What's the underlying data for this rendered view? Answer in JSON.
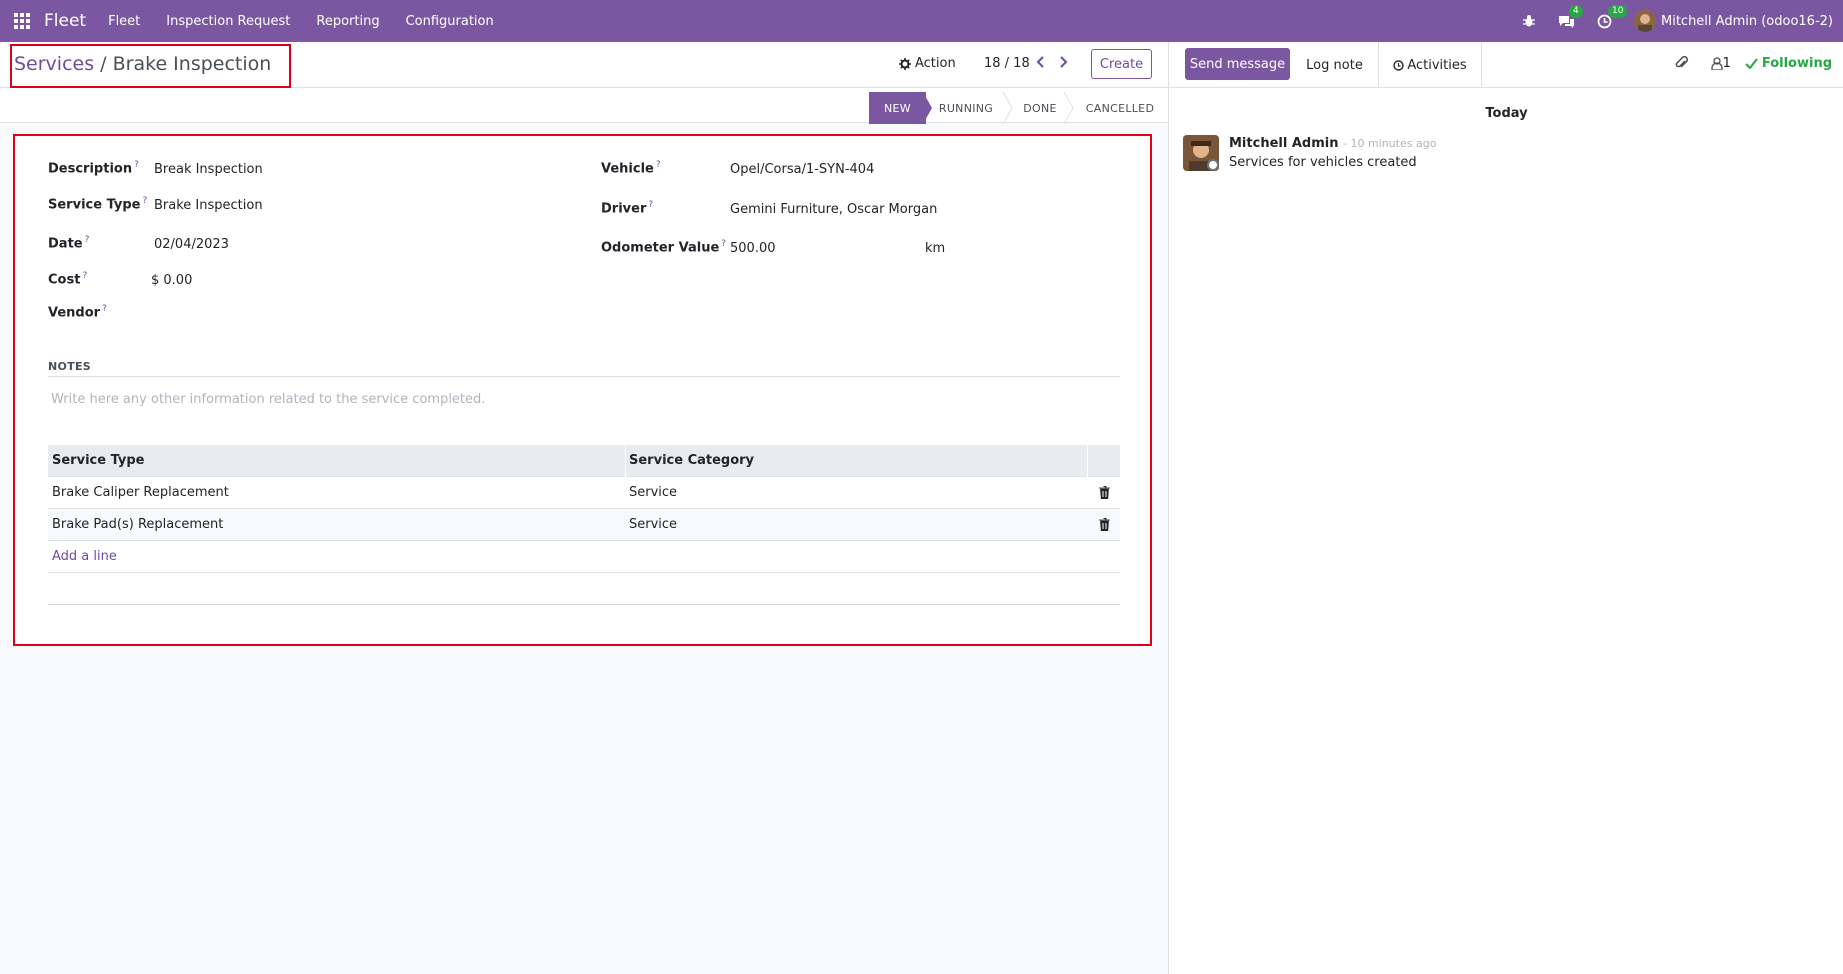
{
  "navbar": {
    "brand": "Fleet",
    "menus": [
      "Fleet",
      "Inspection Request",
      "Reporting",
      "Configuration"
    ],
    "messages_badge": "4",
    "activities_badge": "10",
    "user": "Mitchell Admin (odoo16-2)",
    "icons": [
      "apps-grid-icon",
      "bug-icon",
      "chat-icon",
      "clock-icon"
    ]
  },
  "breadcrumb": {
    "parent": "Services",
    "separator": "/",
    "current": "Brake Inspection"
  },
  "control": {
    "action": "Action",
    "pager": "18 / 18",
    "create": "Create"
  },
  "status": [
    "NEW",
    "RUNNING",
    "DONE",
    "CANCELLED"
  ],
  "status_active": "NEW",
  "form": {
    "description_label": "Description",
    "description": "Break Inspection",
    "service_type_label": "Service Type",
    "service_type": "Brake Inspection",
    "date_label": "Date",
    "date": "02/04/2023",
    "cost_label": "Cost",
    "cost": "$ 0.00",
    "vendor_label": "Vendor",
    "vendor": "",
    "vehicle_label": "Vehicle",
    "vehicle": "Opel/Corsa/1-SYN-404",
    "driver_label": "Driver",
    "driver": "Gemini Furniture, Oscar Morgan",
    "odometer_label": "Odometer Value",
    "odometer": "500.00",
    "odometer_unit": "km",
    "help_mark": "?"
  },
  "notes": {
    "title": "NOTES",
    "placeholder": "Write here any other information related to the service completed."
  },
  "lines": {
    "headers": [
      "Service Type",
      "Service Category"
    ],
    "rows": [
      {
        "type": "Brake Caliper Replacement",
        "category": "Service"
      },
      {
        "type": "Brake Pad(s) Replacement",
        "category": "Service"
      }
    ],
    "add_line": "Add a line"
  },
  "chatter": {
    "send": "Send message",
    "log": "Log note",
    "activities": "Activities",
    "followers_count": "1",
    "following": "Following",
    "date_sep": "Today",
    "messages": [
      {
        "author": "Mitchell Admin",
        "time": "- 10 minutes ago",
        "body": "Services for vehicles created"
      }
    ]
  },
  "colors": {
    "brand": "#7c57a1",
    "highlight": "#e0001b",
    "success": "#28a745"
  }
}
